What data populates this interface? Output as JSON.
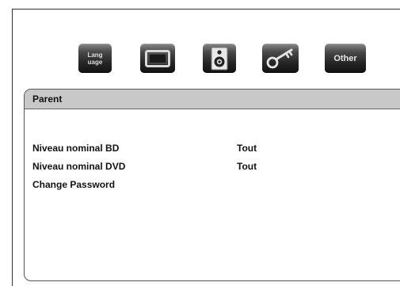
{
  "toolbar": {
    "language": {
      "label_line1": "Lang",
      "label_line2": "uage",
      "icon": "language-icon"
    },
    "display": {
      "icon": "display-icon"
    },
    "audio": {
      "icon": "speaker-icon"
    },
    "parental": {
      "icon": "key-icon"
    },
    "other": {
      "label": "Other",
      "icon": "other-icon"
    }
  },
  "panel": {
    "title": "Parent",
    "rows": [
      {
        "label": "Niveau nominal BD",
        "value": "Tout"
      },
      {
        "label": "Niveau nominal DVD",
        "value": "Tout"
      },
      {
        "label": "Change Password",
        "value": ""
      }
    ]
  },
  "colors": {
    "header_bg": "#c8c8c8",
    "icon_dark": "#1a1a1a",
    "text": "#111111"
  }
}
